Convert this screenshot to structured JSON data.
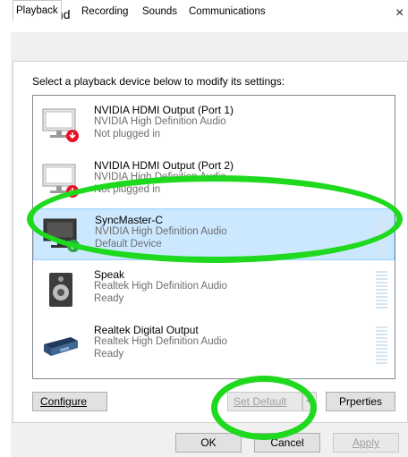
{
  "window": {
    "title": "Sound",
    "close_glyph": "×"
  },
  "tabs": [
    {
      "label": "Playback",
      "active": true
    },
    {
      "label": "Recording",
      "active": false
    },
    {
      "label": "Sounds",
      "active": false
    },
    {
      "label": "Communications",
      "active": false
    }
  ],
  "instruction": "Select a playback device below to modify its settings:",
  "devices": [
    {
      "name": "NVIDIA HDMI Output (Port 1)",
      "driver": "NVIDIA High Definition Audio",
      "status": "Not plugged in",
      "icon": "monitor-icon",
      "badge": "unplugged-badge",
      "selected": false
    },
    {
      "name": "NVIDIA HDMI Output (Port 2)",
      "driver": "NVIDIA High Definition Audio",
      "status": "Not plugged in",
      "icon": "monitor-icon",
      "badge": "unplugged-badge",
      "selected": false
    },
    {
      "name": "SyncMaster-C",
      "driver": "NVIDIA High Definition Audio",
      "status": "Default Device",
      "icon": "monitor-icon",
      "badge": "default-check-badge",
      "selected": true
    },
    {
      "name": "Speak",
      "driver": "Realtek High Definition Audio",
      "status": "Ready",
      "icon": "speaker-icon",
      "badge": "",
      "selected": false
    },
    {
      "name": "Realtek Digital Output",
      "driver": "Realtek High Definition Audio",
      "status": "Ready",
      "icon": "digital-output-icon",
      "badge": "",
      "selected": false
    }
  ],
  "buttons": {
    "configure": "Configure",
    "set_default": "Set Default",
    "properties": "Pr",
    "properties_rest": "perties",
    "ok": "OK",
    "cancel": "Cancel",
    "apply": "Apply"
  },
  "colors": {
    "selection": "#cce8ff",
    "highlight_annotation": "#1ed91e",
    "check_badge": "#2aa845",
    "unplugged_badge": "#e81123"
  }
}
